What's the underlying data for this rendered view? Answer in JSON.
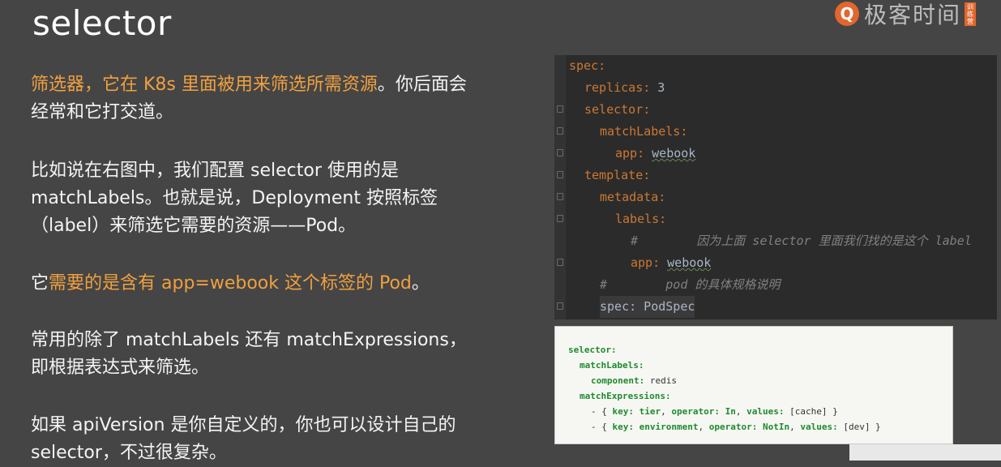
{
  "title": "selector",
  "brand": {
    "name": "极客时间",
    "tag": "训练营"
  },
  "paragraphs": {
    "p1_hl": "筛选器，它在 K8s 里面被用来筛选所需资源",
    "p1_rest": "。你后面会",
    "p1_line2": "经常和它打交道。",
    "p2_line1": "比如说在右图中，我们配置 selector 使用的是",
    "p2_line2": "matchLabels。也就是说，Deployment 按照标签",
    "p2_line3": "（label）来筛选它需要的资源——Pod。",
    "p3_pre": "它",
    "p3_hl": "需要的是含有 app=webook 这个标签的 Pod",
    "p3_post": "。",
    "p4_line1": "常用的除了 matchLabels 还有 matchExpressions，",
    "p4_line2": "即根据表达式来筛选。",
    "p5_line1": "如果 apiVersion 是你自定义的，你也可以设计自己的",
    "p5_line2": "selector，不过很复杂。"
  },
  "editor": {
    "l1": "spec:",
    "l2k": "replicas:",
    "l2v": " 3",
    "l3": "selector:",
    "l4": "matchLabels:",
    "l5k": "app:",
    "l5v": "webook",
    "l6": "template:",
    "l7": "metadata:",
    "l8": "labels:",
    "l9": "#        因为上面 selector 里面我们找的是这个 label",
    "l10k": "app:",
    "l10v": "webook",
    "l11": "#        pod 的具体规格说明",
    "l12": "spec: PodSpec"
  },
  "snippet": {
    "s1": "selector:",
    "s2": "matchLabels:",
    "s3k": "component:",
    "s3v": " redis",
    "s4": "matchExpressions:",
    "s5a": "- { ",
    "s5k1": "key:",
    "s5v1": " tier",
    "s5s1": ", ",
    "s5k2": "operator:",
    "s5v2": " In",
    "s5s2": ", ",
    "s5k3": "values:",
    "s5v3": " [cache] }",
    "s6a": "- { ",
    "s6k1": "key:",
    "s6v1": " environment",
    "s6s1": ", ",
    "s6k2": "operator:",
    "s6v2": " NotIn",
    "s6s2": ", ",
    "s6k3": "values:",
    "s6v3": " [dev] }"
  },
  "colors": {
    "background": "#454545",
    "highlight": "#f0a040",
    "editor_bg": "#2b2b2b",
    "yaml_key": "#cc7832",
    "snippet_key": "#1f8a2e"
  },
  "icons": {
    "brand_logo": "geektime-logo-icon"
  }
}
